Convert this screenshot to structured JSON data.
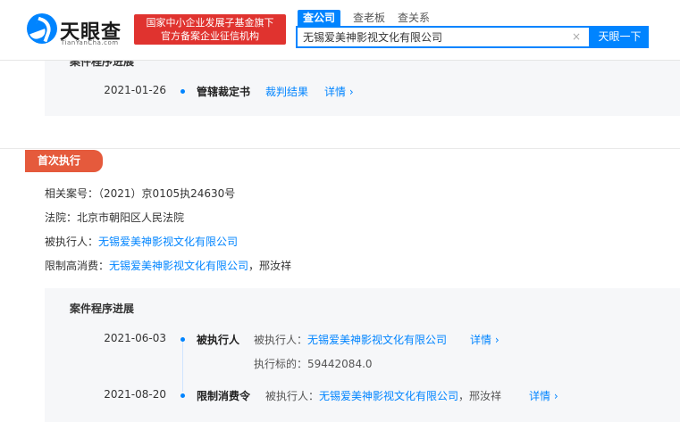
{
  "header": {
    "logo_text": "天眼查",
    "logo_sub": "TianYanCha.com",
    "banner_line1": "国家中小企业发展子基金旗下",
    "banner_line2": "官方备案企业征信机构",
    "tabs": [
      "查公司",
      "查老板",
      "查关系"
    ],
    "search_value": "无锡爱美神影视文化有限公司",
    "search_button": "天眼一下"
  },
  "top_panel": {
    "title": "案件程序进展",
    "row": {
      "date": "2021-01-26",
      "type": "管辖裁定书",
      "link": "裁判结果",
      "more": "详情"
    }
  },
  "section": {
    "tag": "首次执行",
    "case_label": "相关案号：",
    "case_value": "（2021）京0105执24630号",
    "court_label": "法院：",
    "court_value": "北京市朝阳区人民法院",
    "executed_label": "被执行人：",
    "executed_value": "无锡爱美神影视文化有限公司",
    "restrict_label": "限制高消费：",
    "restrict_company": "无锡爱美神影视文化有限公司",
    "restrict_person": "，邢汝祥"
  },
  "bottom_panel": {
    "title": "案件程序进展",
    "rows": [
      {
        "date": "2021-06-03",
        "type": "被执行人",
        "label": "被执行人：",
        "company": "无锡爱美神影视文化有限公司",
        "more": "详情",
        "extra": "执行标的：59442084.0"
      },
      {
        "date": "2021-08-20",
        "type": "限制消费令",
        "label": "被执行人：",
        "company": "无锡爱美神影视文化有限公司",
        "person": "，邢汝祥",
        "more": "详情"
      }
    ]
  },
  "colors": {
    "brand_blue": "#0084ff",
    "banner_red": "#e0332f",
    "tag_orange": "#e55a3c",
    "panel_gray": "#f6f7f9"
  }
}
